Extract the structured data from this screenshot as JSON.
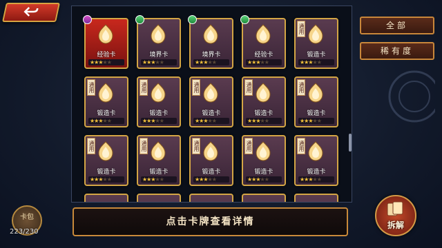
{
  "nav": {
    "back_icon": "back-arrow-icon"
  },
  "filters": {
    "all_label": "全部",
    "rarity_label": "稀有度"
  },
  "tag_text": "通用",
  "rows": [
    [
      {
        "name": "经验卡",
        "stars": 3,
        "style": "red",
        "rarity": "pink",
        "tag": false
      },
      {
        "name": "境界卡",
        "stars": 3,
        "style": "gold",
        "rarity": "green",
        "tag": false
      },
      {
        "name": "境界卡",
        "stars": 3,
        "style": "gold",
        "rarity": "green",
        "tag": false
      },
      {
        "name": "经验卡",
        "stars": 3,
        "style": "gold",
        "rarity": "green",
        "tag": false
      },
      {
        "name": "锻造卡",
        "stars": 3,
        "style": "gold",
        "rarity": "",
        "tag": true
      }
    ],
    [
      {
        "name": "锻造卡",
        "stars": 3,
        "style": "gold",
        "rarity": "",
        "tag": true
      },
      {
        "name": "锻造卡",
        "stars": 3,
        "style": "gold",
        "rarity": "",
        "tag": true
      },
      {
        "name": "锻造卡",
        "stars": 3,
        "style": "gold",
        "rarity": "",
        "tag": true
      },
      {
        "name": "锻造卡",
        "stars": 3,
        "style": "gold",
        "rarity": "",
        "tag": true
      },
      {
        "name": "锻造卡",
        "stars": 3,
        "style": "gold",
        "rarity": "",
        "tag": true
      }
    ],
    [
      {
        "name": "锻造卡",
        "stars": 3,
        "style": "gold",
        "rarity": "",
        "tag": true
      },
      {
        "name": "锻造卡",
        "stars": 3,
        "style": "gold",
        "rarity": "",
        "tag": true
      },
      {
        "name": "锻造卡",
        "stars": 3,
        "style": "gold",
        "rarity": "",
        "tag": true
      },
      {
        "name": "锻造卡",
        "stars": 3,
        "style": "gold",
        "rarity": "",
        "tag": true
      },
      {
        "name": "锻造卡",
        "stars": 3,
        "style": "gold",
        "rarity": "",
        "tag": true
      }
    ]
  ],
  "max_stars": 5,
  "hint_text": "点击卡牌查看详情",
  "bag": {
    "label": "卡包",
    "count": "223/230"
  },
  "dismantle": {
    "label": "拆解",
    "icon": "dismantle-icon"
  }
}
